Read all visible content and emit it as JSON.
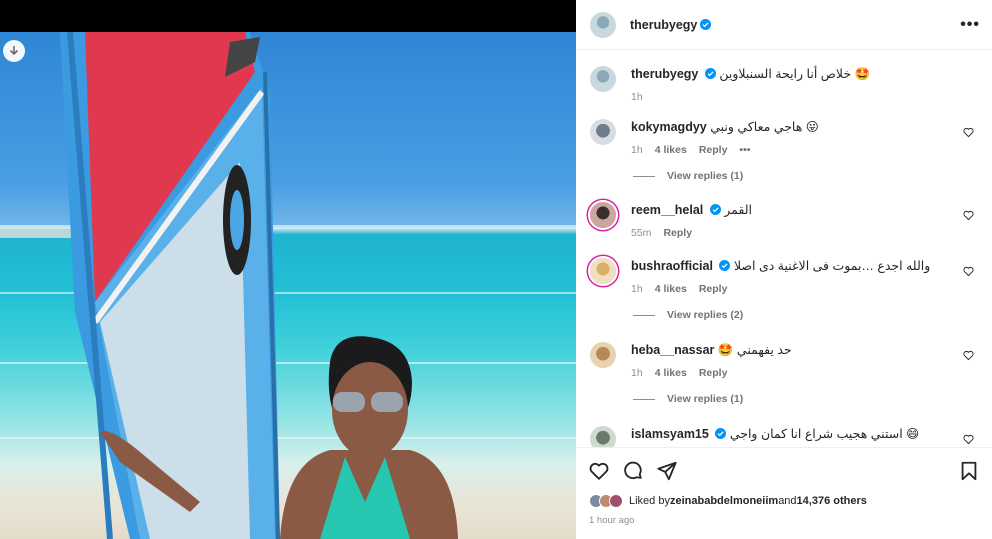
{
  "post": {
    "author": "therubyegy",
    "caption": "خلاص أنا رايحة السنبلاوين 🤩",
    "caption_time": "1h"
  },
  "comments": [
    {
      "user": "kokymagdyy",
      "text": "هاجي معاكي ونبي 😛",
      "time": "1h",
      "likes": "4 likes",
      "reply": "Reply",
      "more": "•••",
      "view_replies": "View replies (1)"
    },
    {
      "user": "reem__helal",
      "verified": true,
      "text": "القمر",
      "time": "55m",
      "reply": "Reply"
    },
    {
      "user": "bushraofficial",
      "verified": true,
      "text": "والله اجدع …بموت فى الاغنية دى اصلا",
      "time": "1h",
      "likes": "4 likes",
      "reply": "Reply",
      "view_replies": "View replies (2)"
    },
    {
      "user": "heba__nassar",
      "text": "🤩 حد يفهمني",
      "time": "1h",
      "likes": "4 likes",
      "reply": "Reply",
      "view_replies": "View replies (1)"
    },
    {
      "user": "islamsyam15",
      "verified": true,
      "text": "استني هجيب شراع انا كمان واجي 😄"
    }
  ],
  "likes_line": {
    "prefix": "Liked by ",
    "user": "zeinababdelmoneiim",
    "middle": " and ",
    "count": "14,376 others"
  },
  "timestamp": "1 hour ago",
  "icons": [
    "download-icon",
    "verified-icon",
    "more-icon",
    "heart-icon",
    "comment-icon",
    "share-icon",
    "save-icon"
  ],
  "colors": {
    "verified": "#0095f6",
    "text": "#262626",
    "muted": "#8e8e8e",
    "sail_red": "#e0384f",
    "sail_blue": "#3b9be0"
  }
}
